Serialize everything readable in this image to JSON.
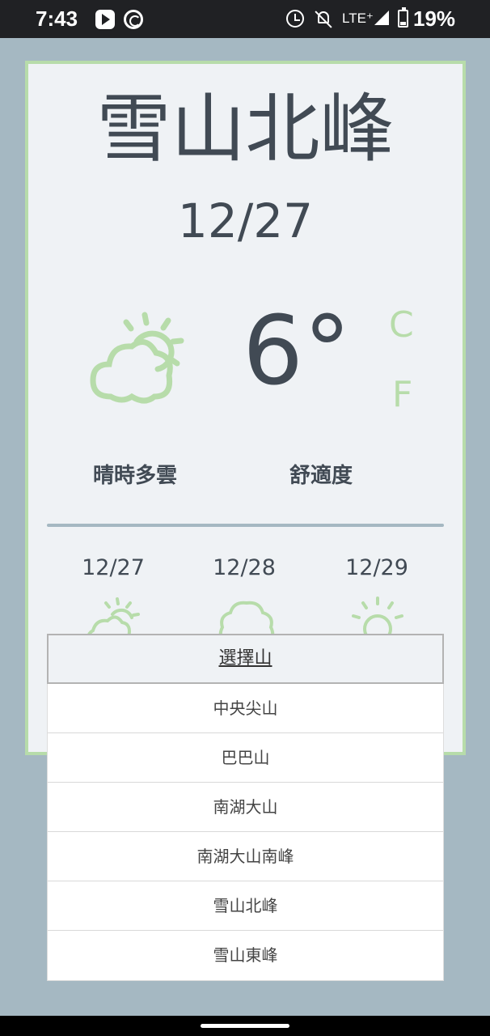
{
  "status_bar": {
    "time": "7:43",
    "network": "LTE⁺",
    "battery": "19%"
  },
  "weather": {
    "mountain": "雪山北峰",
    "date": "12/27",
    "temperature": "6°",
    "unit_c": "C",
    "unit_f": "F",
    "condition": "晴時多雲",
    "comfort": "舒適度",
    "icon": "partly-cloudy-icon",
    "accent_color": "#b7dcaa"
  },
  "forecast": [
    {
      "date": "12/27",
      "icon": "partly-cloudy-icon"
    },
    {
      "date": "12/28",
      "icon": "cloud-icon"
    },
    {
      "date": "12/29",
      "icon": "sun-icon"
    }
  ],
  "dropdown": {
    "header": "選擇山",
    "items": [
      "中央尖山",
      "巴巴山",
      "南湖大山",
      "南湖大山南峰",
      "雪山北峰",
      "雪山東峰"
    ]
  }
}
